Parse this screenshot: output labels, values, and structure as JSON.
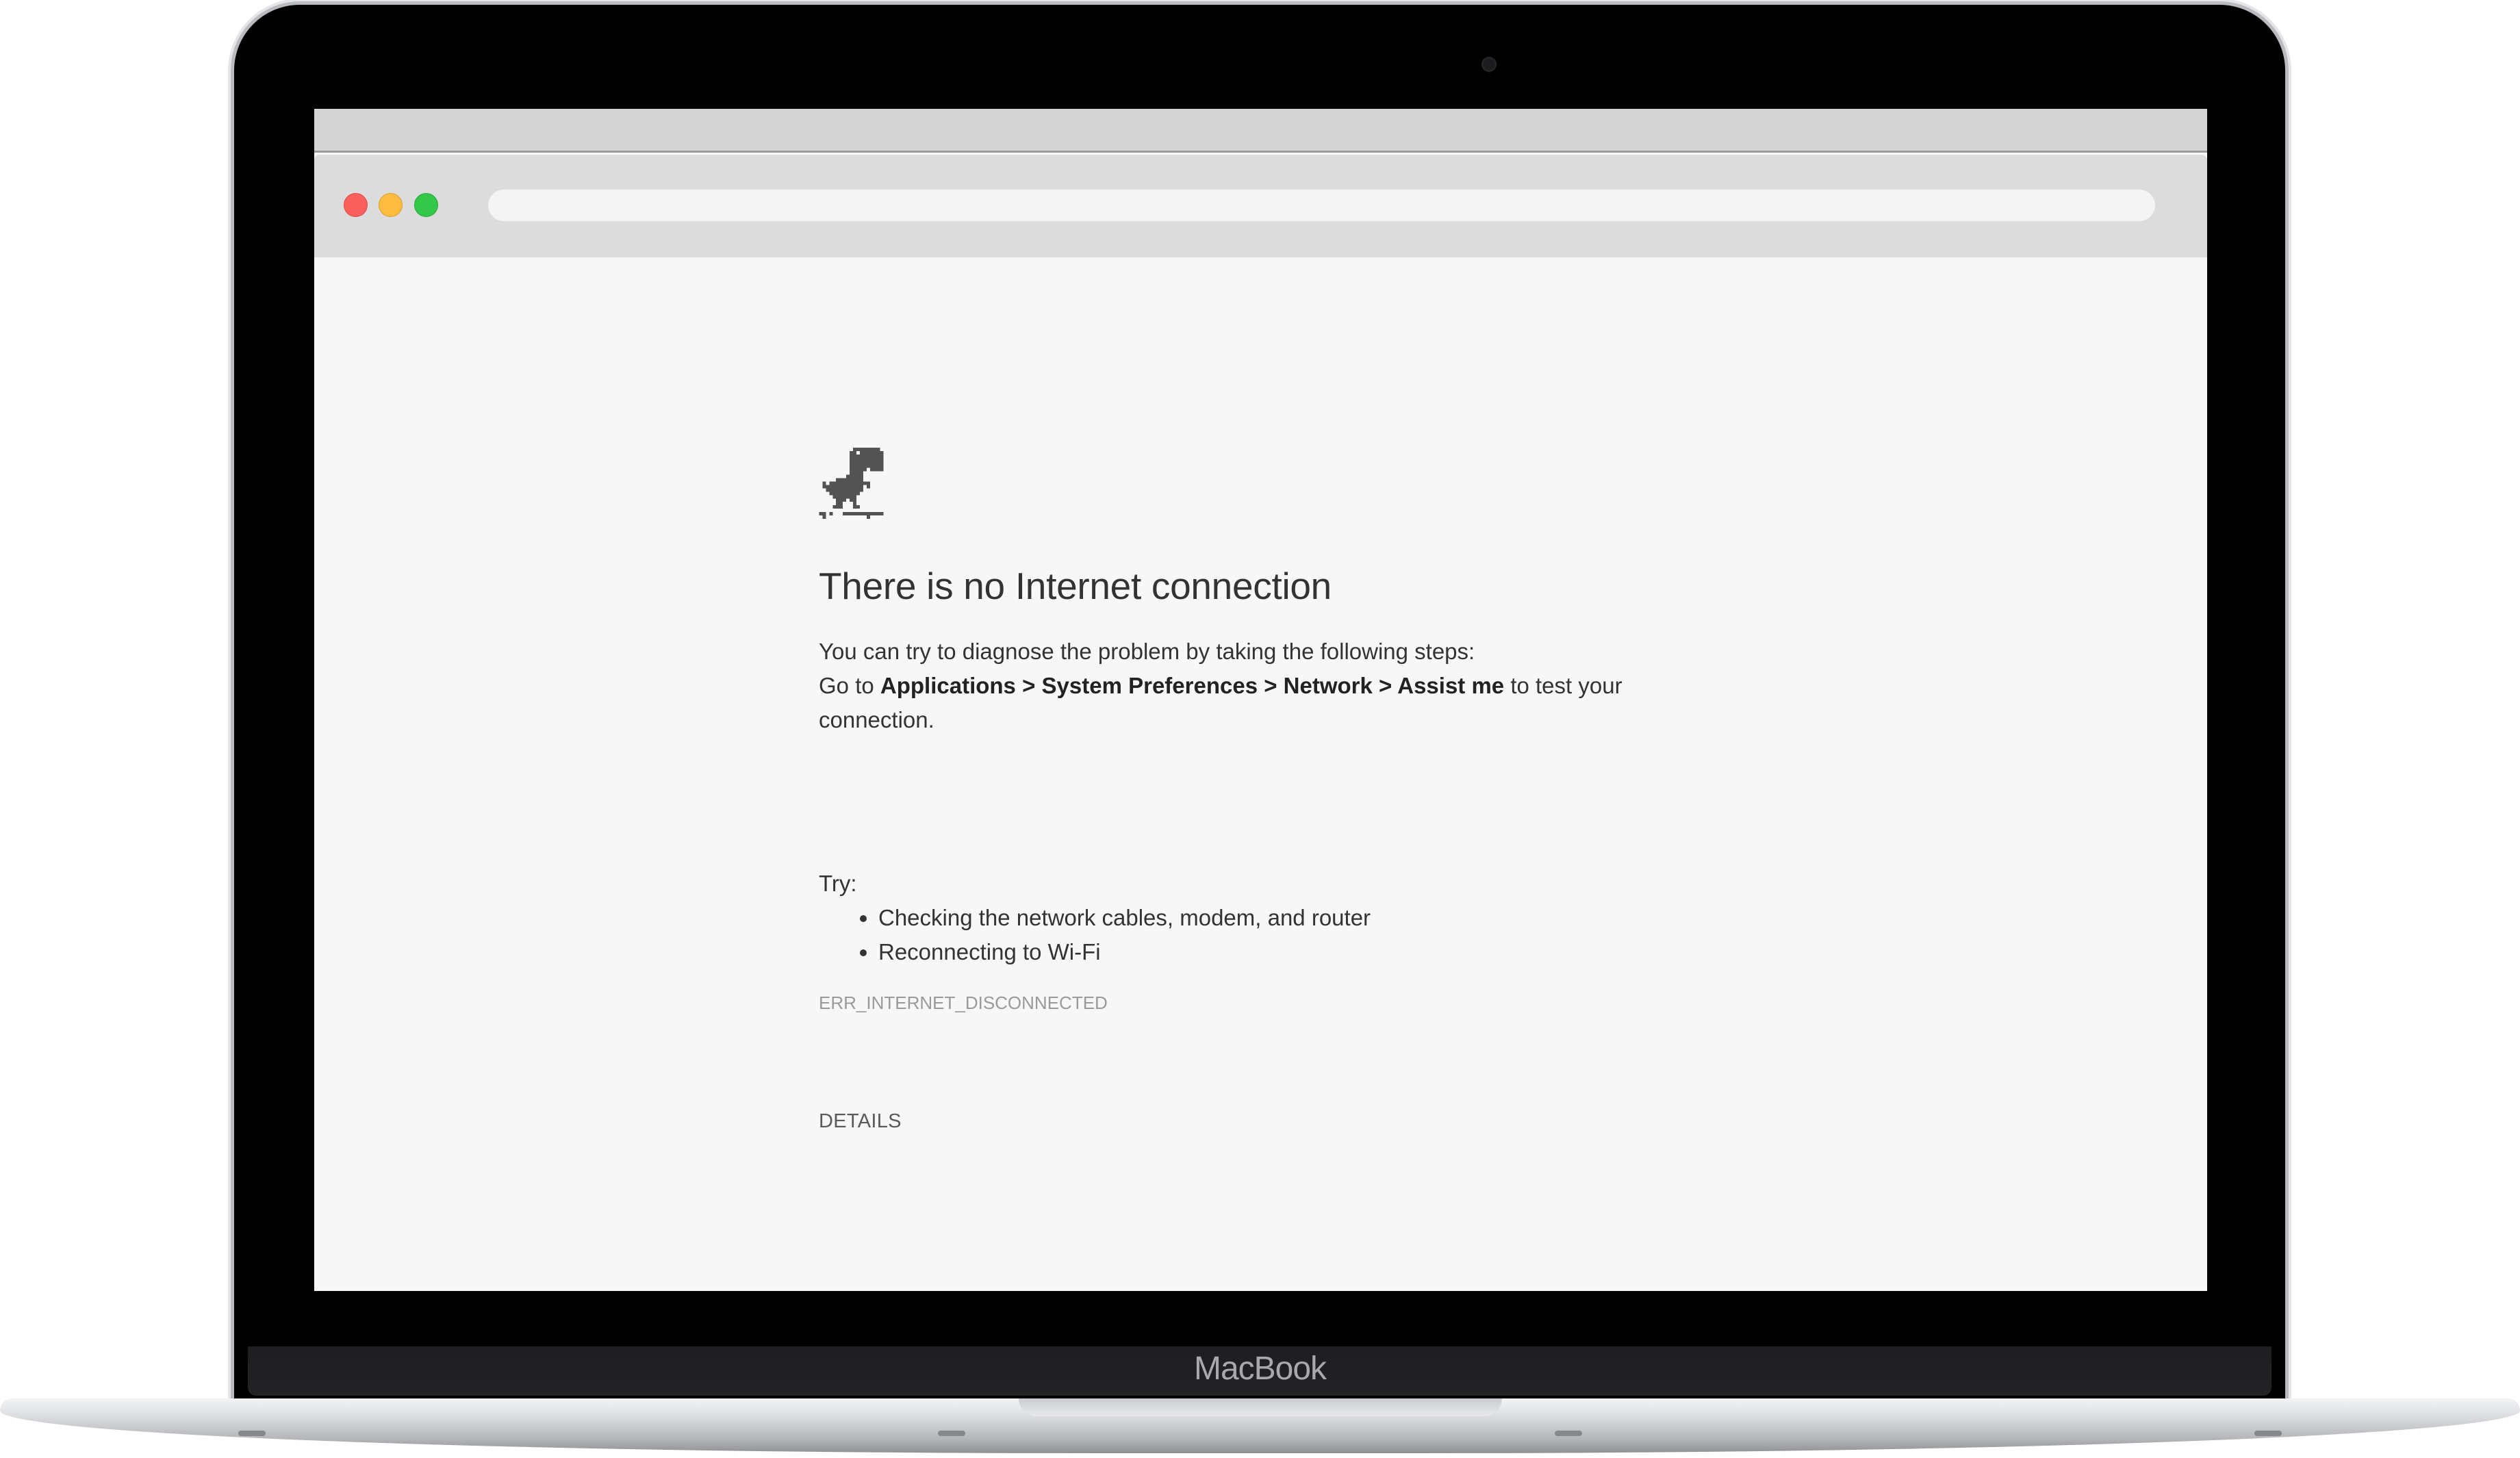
{
  "device": {
    "brand_label": "MacBook"
  },
  "browser": {
    "traffic_lights": {
      "close_color": "#fc605c",
      "minimize_color": "#fdbc40",
      "zoom_color": "#34c84a"
    },
    "address_bar": {
      "value": "",
      "placeholder": ""
    }
  },
  "error_page": {
    "icon": "offline-dinosaur-icon",
    "title": "There is no Internet connection",
    "intro": "You can try to diagnose the problem by taking the following steps:",
    "goto_prefix": "Go to ",
    "goto_path": "Applications > System Preferences > Network > Assist me",
    "goto_suffix": " to test your connection.",
    "try_label": "Try:",
    "suggestions": [
      "Checking the network cables, modem, and router",
      "Reconnecting to Wi-Fi"
    ],
    "error_code": "ERR_INTERNET_DISCONNECTED",
    "details_label": "DETAILS"
  }
}
